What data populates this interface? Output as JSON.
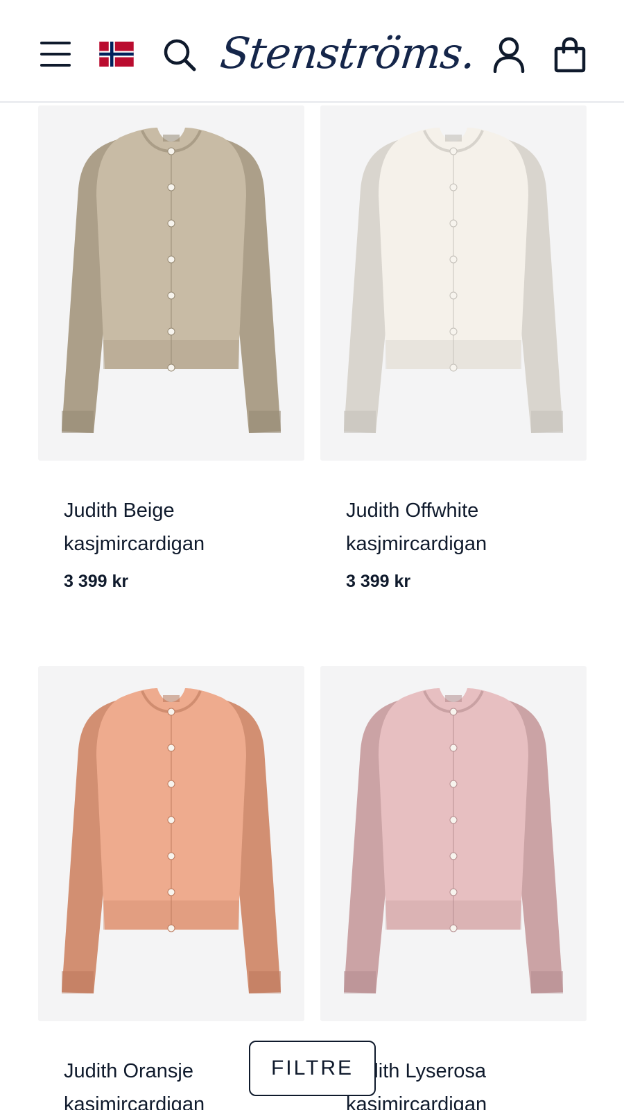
{
  "header": {
    "logo_text": "Stenströms.",
    "icons": {
      "menu": "menu-icon",
      "flag": "norway-flag-icon",
      "search": "search-icon",
      "account": "user-icon",
      "cart": "shopping-bag-icon"
    },
    "brand_color": "#15264a"
  },
  "products": [
    {
      "title": "Judith Beige kasjmircardigan",
      "price": "3 399 kr",
      "color": "#c8bba5"
    },
    {
      "title": "Judith Offwhite kasjmircardigan",
      "price": "3 399 kr",
      "color": "#f5f1ea"
    },
    {
      "title": "Judith Oransje kasjmircardigan",
      "price": "",
      "color": "#eeab8e"
    },
    {
      "title": "Judith Lyserosa kasjmircardigan",
      "price": "",
      "color": "#e7bfc1"
    }
  ],
  "filter": {
    "label": "FILTRE"
  }
}
